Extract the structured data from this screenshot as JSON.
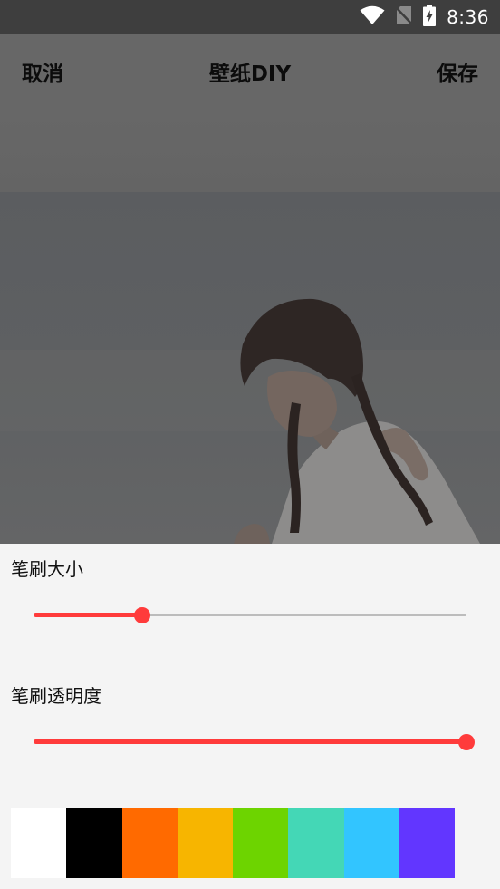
{
  "status_bar": {
    "time": "8:36",
    "icons": [
      "wifi-icon",
      "no-sim-icon",
      "battery-charging-icon"
    ]
  },
  "toolbar": {
    "cancel_label": "取消",
    "title": "壁纸DIY",
    "save_label": "保存"
  },
  "controls": {
    "brush_size": {
      "label": "笔刷大小",
      "value_fraction": 0.25
    },
    "brush_opacity": {
      "label": "笔刷透明度",
      "value_fraction": 1.0
    }
  },
  "palette": {
    "colors": [
      "#ffffff",
      "#000000",
      "#ff6a00",
      "#f7b500",
      "#6dd400",
      "#44d7b6",
      "#32c5ff",
      "#6236ff"
    ]
  },
  "theme": {
    "accent": "#ff3b3b",
    "overlay": "#676767",
    "panel": "#f4f4f4"
  }
}
